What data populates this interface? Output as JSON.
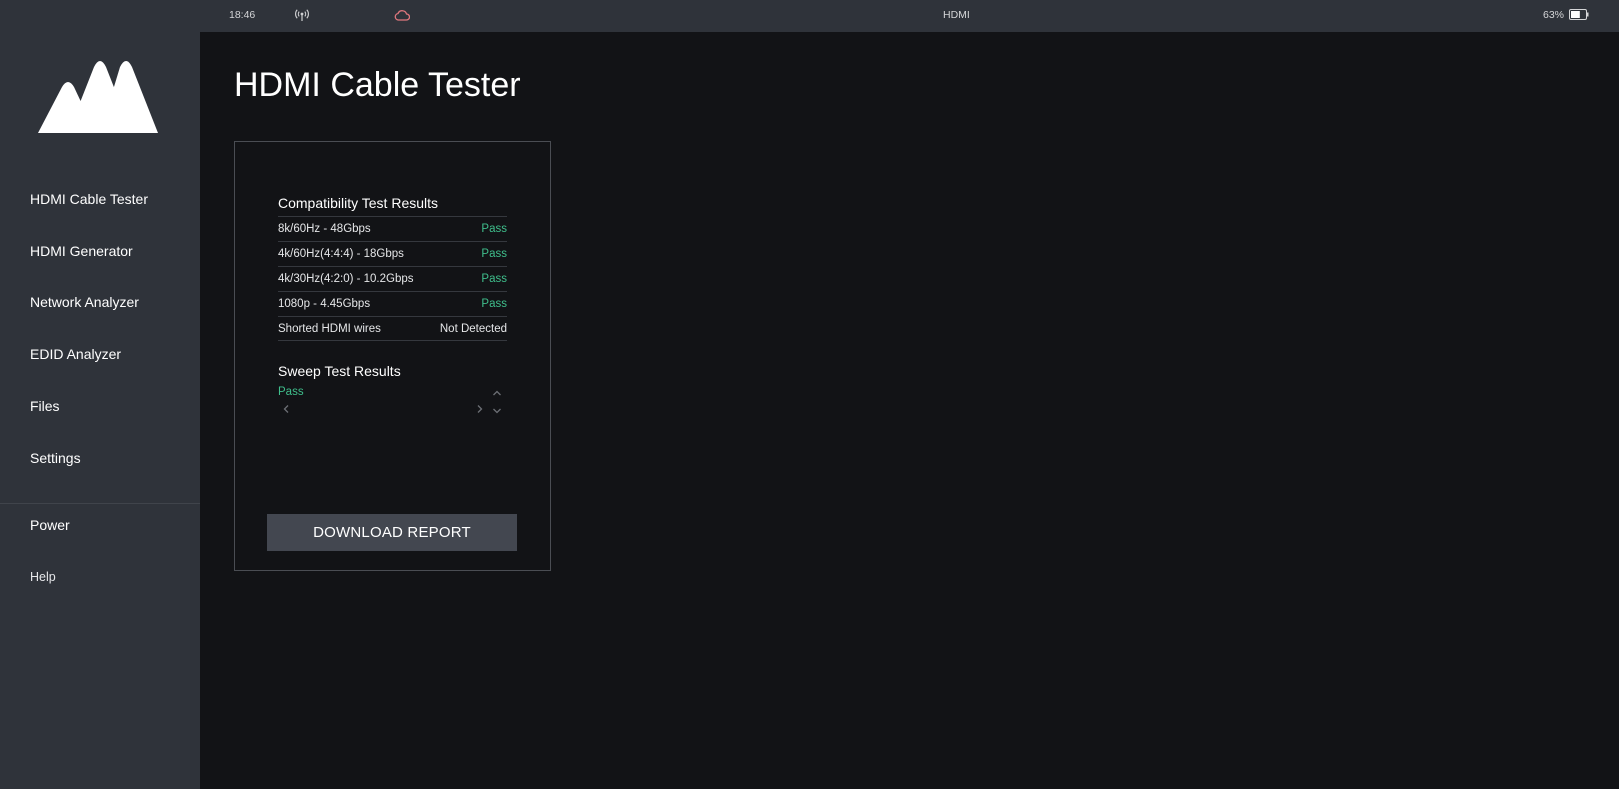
{
  "status_bar": {
    "time": "18:46",
    "center_label": "HDMI",
    "battery_percent": "63%",
    "battery_level": 0.63,
    "icons": [
      "wireless-signal-icon",
      "cloud-icon",
      "battery-icon"
    ]
  },
  "sidebar": {
    "logo": "brand-logo",
    "items": [
      {
        "label": "HDMI Cable Tester"
      },
      {
        "label": "HDMI Generator"
      },
      {
        "label": "Network Analyzer"
      },
      {
        "label": "EDID Analyzer"
      },
      {
        "label": "Files"
      },
      {
        "label": "Settings"
      }
    ],
    "bottom_items": [
      {
        "label": "Power"
      },
      {
        "label": "Help"
      }
    ]
  },
  "main": {
    "title": "HDMI Cable Tester",
    "compatibility": {
      "title": "Compatibility Test Results",
      "rows": [
        {
          "label": "8k/60Hz - 48Gbps",
          "value": "Pass"
        },
        {
          "label": "4k/60Hz(4:4:4) - 18Gbps",
          "value": "Pass"
        },
        {
          "label": "4k/30Hz(4:2:0) - 10.2Gbps",
          "value": "Pass"
        },
        {
          "label": "1080p - 4.45Gbps",
          "value": "Pass"
        },
        {
          "label": "Shorted HDMI wires",
          "value": "Not Detected"
        }
      ]
    },
    "sweep": {
      "title": "Sweep Test Results",
      "value": "Pass"
    },
    "download_label": "DOWNLOAD REPORT"
  },
  "colors": {
    "pass": "#3fbf8c",
    "sidebar_bg": "#2f333a",
    "main_bg": "#121316",
    "button_bg": "#434750",
    "cloud_icon": "#e0777d"
  }
}
